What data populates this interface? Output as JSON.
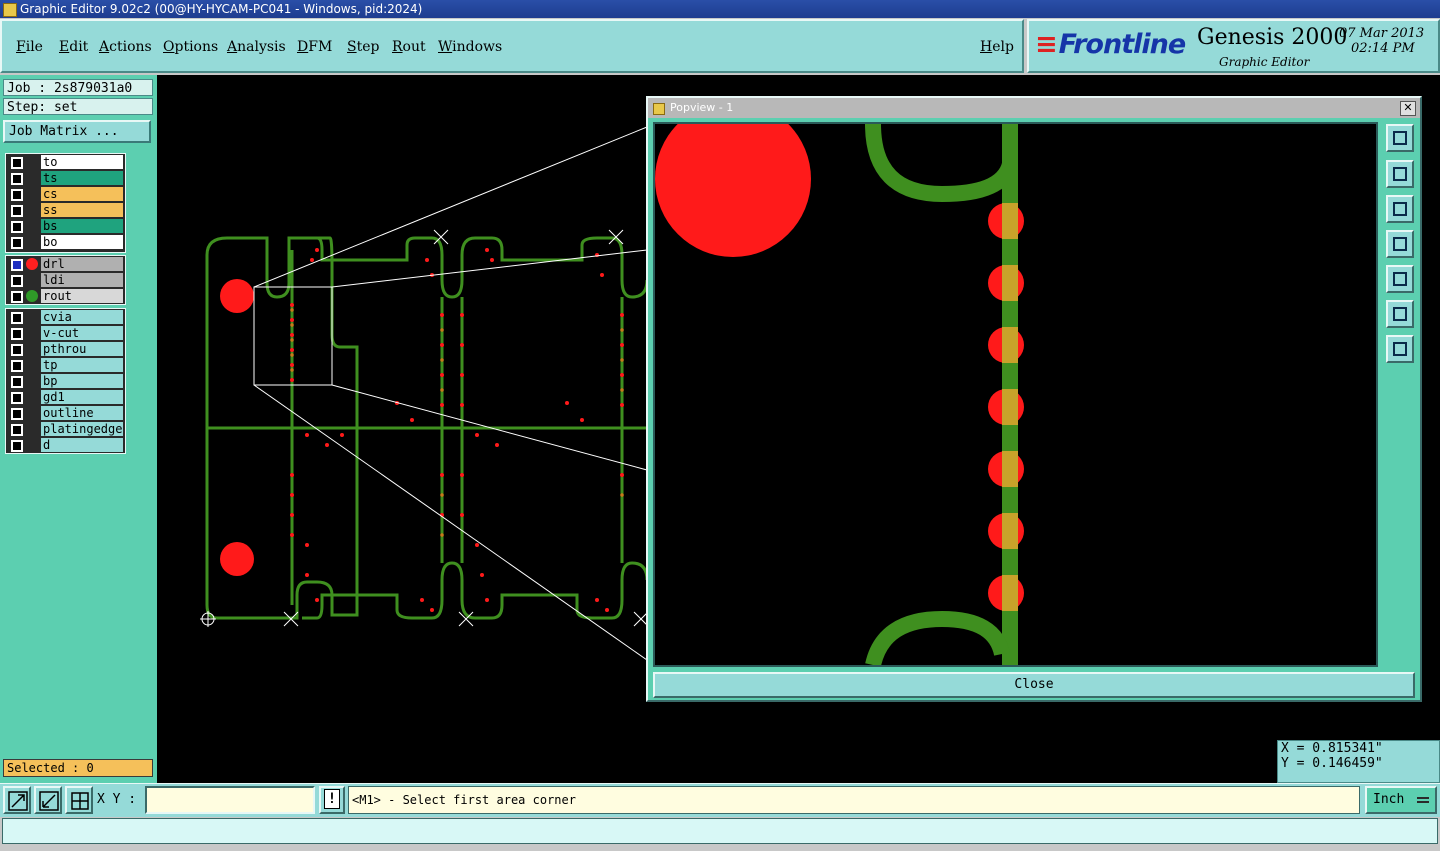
{
  "window": {
    "title": "Graphic Editor 9.02c2 (00@HY-HYCAM-PC041 - Windows, pid:2024)"
  },
  "menu": {
    "items": [
      "File",
      "Edit",
      "Actions",
      "Options",
      "Analysis",
      "DFM",
      "Step",
      "Rout",
      "Windows"
    ],
    "help": "Help"
  },
  "brand": {
    "company": "Frontline",
    "product": "Genesis 2000",
    "subtitle": "Graphic Editor",
    "date": "07 Mar 2013",
    "time": "02:14 PM"
  },
  "left_panel": {
    "job": "Job : 2s879031a0",
    "step": "Step: set",
    "job_matrix": "Job Matrix ...",
    "selected": "Selected : 0"
  },
  "layers": {
    "board": [
      {
        "name": "to",
        "color": "#ffffff"
      },
      {
        "name": "ts",
        "color": "#1fa37e"
      },
      {
        "name": "cs",
        "color": "#f5c05a"
      },
      {
        "name": "ss",
        "color": "#f5c05a"
      },
      {
        "name": "bs",
        "color": "#1fa37e"
      },
      {
        "name": "bo",
        "color": "#ffffff"
      }
    ],
    "drill": [
      {
        "name": "drl",
        "color": "#b0b0b0",
        "dot": "#ff2020",
        "active": true
      },
      {
        "name": "ldi",
        "color": "#b0b0b0",
        "dot": ""
      },
      {
        "name": "rout",
        "color": "#d8d8d8",
        "dot": "#2f9a28"
      }
    ],
    "misc": [
      {
        "name": "cvia",
        "color": "#95dad8"
      },
      {
        "name": "v-cut",
        "color": "#95dad8"
      },
      {
        "name": "pthrou",
        "color": "#95dad8"
      },
      {
        "name": "tp",
        "color": "#95dad8"
      },
      {
        "name": "bp",
        "color": "#95dad8"
      },
      {
        "name": "gd1",
        "color": "#95dad8"
      },
      {
        "name": "outline",
        "color": "#95dad8"
      },
      {
        "name": "platingedge",
        "color": "#95dad8"
      },
      {
        "name": "d",
        "color": "#95dad8"
      }
    ]
  },
  "popup": {
    "title": "Popview - 1",
    "close_x": "✕",
    "close_label": "Close"
  },
  "coords": {
    "x": "X = 0.815341\"",
    "y": "Y = 0.146459\""
  },
  "bottom": {
    "xy_label": "X Y :",
    "xy_value": "",
    "prompt": "<M1> - Select first area corner",
    "units": "Inch",
    "warn": "!"
  },
  "colors": {
    "rout": "#3f8f1f",
    "drill": "#ff1a1a",
    "pad": "#c87a1a"
  }
}
